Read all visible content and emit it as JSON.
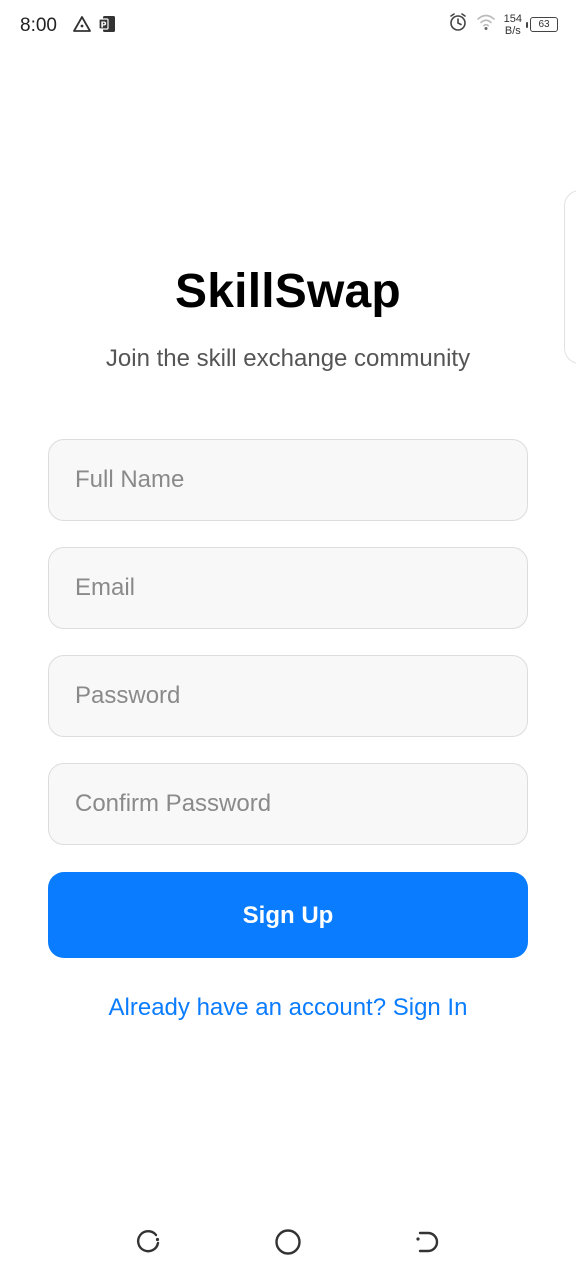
{
  "status_bar": {
    "time": "8:00",
    "left_icons": [
      "warning-triangle-icon",
      "app-notification-icon"
    ],
    "right_icons": [
      "alarm-icon",
      "wifi-icon"
    ],
    "net_speed_value": "154",
    "net_speed_unit": "B/s",
    "battery_level": "63"
  },
  "app": {
    "title": "SkillSwap",
    "subtitle": "Join the skill exchange community"
  },
  "form": {
    "full_name_placeholder": "Full Name",
    "email_placeholder": "Email",
    "password_placeholder": "Password",
    "confirm_password_placeholder": "Confirm Password",
    "submit_label": "Sign Up",
    "signin_link": "Already have an account? Sign In"
  },
  "colors": {
    "primary": "#0a7cff",
    "field_background": "#f8f8f8",
    "field_border": "#dcdcdc",
    "title_text": "#000000",
    "subtitle_text": "#555555"
  },
  "nav_bar": {
    "buttons": [
      "recents-icon",
      "home-icon",
      "back-icon"
    ]
  }
}
